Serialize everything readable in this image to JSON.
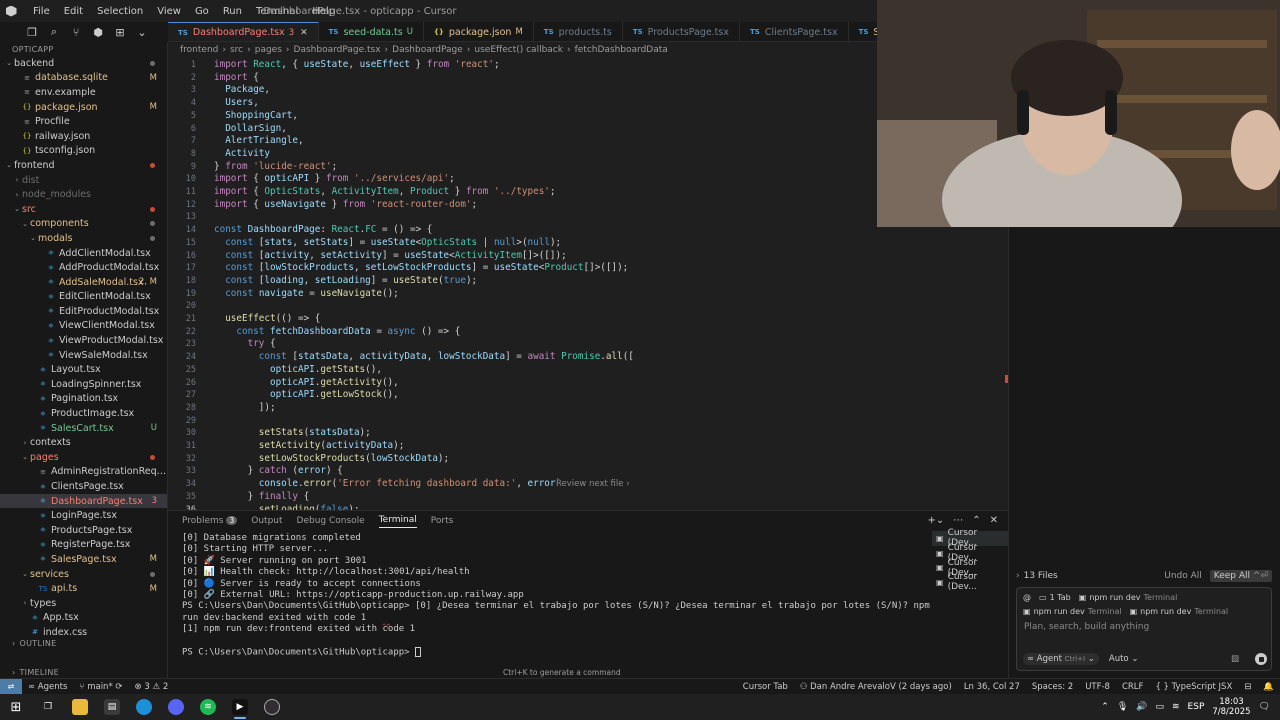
{
  "window": {
    "title": "DashboardPage.tsx - opticapp - Cursor",
    "menu": [
      "File",
      "Edit",
      "Selection",
      "View",
      "Go",
      "Run",
      "Terminal",
      "Help"
    ]
  },
  "explorer": {
    "root": "OPTICAPP",
    "items": [
      {
        "label": "backend",
        "kind": "dir",
        "depth": 0,
        "open": true,
        "status": "dot"
      },
      {
        "label": "database.sqlite",
        "kind": "file",
        "depth": 1,
        "status": "M",
        "color": "mod"
      },
      {
        "label": "env.example",
        "kind": "file",
        "depth": 1
      },
      {
        "label": "package.json",
        "kind": "file",
        "depth": 1,
        "status": "M",
        "color": "mod"
      },
      {
        "label": "Procfile",
        "kind": "file",
        "depth": 1
      },
      {
        "label": "railway.json",
        "kind": "file",
        "depth": 1
      },
      {
        "label": "tsconfig.json",
        "kind": "file",
        "depth": 1
      },
      {
        "label": "frontend",
        "kind": "dir",
        "depth": 0,
        "open": true,
        "status": "reddot"
      },
      {
        "label": "dist",
        "kind": "dir",
        "depth": 1,
        "open": false,
        "color": "dim"
      },
      {
        "label": "node_modules",
        "kind": "dir",
        "depth": 1,
        "open": false,
        "color": "dim"
      },
      {
        "label": "src",
        "kind": "dir",
        "depth": 1,
        "open": true,
        "color": "err",
        "status": "reddot"
      },
      {
        "label": "components",
        "kind": "dir",
        "depth": 2,
        "open": true,
        "color": "mod",
        "status": "dot"
      },
      {
        "label": "modals",
        "kind": "dir",
        "depth": 3,
        "open": true,
        "color": "mod",
        "status": "dot"
      },
      {
        "label": "AddClientModal.tsx",
        "kind": "file",
        "depth": 4
      },
      {
        "label": "AddProductModal.tsx",
        "kind": "file",
        "depth": 4
      },
      {
        "label": "AddSaleModal.tsx",
        "kind": "file",
        "depth": 4,
        "status": "2, M",
        "color": "mod"
      },
      {
        "label": "EditClientModal.tsx",
        "kind": "file",
        "depth": 4
      },
      {
        "label": "EditProductModal.tsx",
        "kind": "file",
        "depth": 4
      },
      {
        "label": "ViewClientModal.tsx",
        "kind": "file",
        "depth": 4
      },
      {
        "label": "ViewProductModal.tsx",
        "kind": "file",
        "depth": 4
      },
      {
        "label": "ViewSaleModal.tsx",
        "kind": "file",
        "depth": 4
      },
      {
        "label": "Layout.tsx",
        "kind": "file",
        "depth": 3
      },
      {
        "label": "LoadingSpinner.tsx",
        "kind": "file",
        "depth": 3
      },
      {
        "label": "Pagination.tsx",
        "kind": "file",
        "depth": 3
      },
      {
        "label": "ProductImage.tsx",
        "kind": "file",
        "depth": 3
      },
      {
        "label": "SalesCart.tsx",
        "kind": "file",
        "depth": 3,
        "status": "U",
        "color": "new"
      },
      {
        "label": "contexts",
        "kind": "dir",
        "depth": 2,
        "open": false
      },
      {
        "label": "pages",
        "kind": "dir",
        "depth": 2,
        "open": true,
        "color": "err",
        "status": "reddot"
      },
      {
        "label": "AdminRegistrationRequestsPag...",
        "kind": "file",
        "depth": 3
      },
      {
        "label": "ClientsPage.tsx",
        "kind": "file",
        "depth": 3
      },
      {
        "label": "DashboardPage.tsx",
        "kind": "file",
        "depth": 3,
        "status": "3",
        "color": "err",
        "selected": true
      },
      {
        "label": "LoginPage.tsx",
        "kind": "file",
        "depth": 3
      },
      {
        "label": "ProductsPage.tsx",
        "kind": "file",
        "depth": 3
      },
      {
        "label": "RegisterPage.tsx",
        "kind": "file",
        "depth": 3
      },
      {
        "label": "SalesPage.tsx",
        "kind": "file",
        "depth": 3,
        "status": "M",
        "color": "mod"
      },
      {
        "label": "services",
        "kind": "dir",
        "depth": 2,
        "open": true,
        "color": "mod",
        "status": "dot"
      },
      {
        "label": "api.ts",
        "kind": "file",
        "depth": 3,
        "status": "M",
        "color": "mod"
      },
      {
        "label": "types",
        "kind": "dir",
        "depth": 2,
        "open": false
      },
      {
        "label": "App.tsx",
        "kind": "file",
        "depth": 2
      },
      {
        "label": "index.css",
        "kind": "file",
        "depth": 2
      }
    ],
    "outline": "OUTLINE",
    "timeline": "TIMELINE"
  },
  "tabs": [
    {
      "label": "DashboardPage.tsx",
      "badge": "3",
      "color": "err",
      "active": true,
      "icon": "TS"
    },
    {
      "label": "seed-data.ts",
      "badge": "U",
      "color": "new",
      "icon": "TS"
    },
    {
      "label": "package.json",
      "badge": "M",
      "color": "mod",
      "icon": "{}"
    },
    {
      "label": "products.ts",
      "badge": "",
      "color": "dim",
      "icon": "TS"
    },
    {
      "label": "ProductsPage.tsx",
      "badge": "",
      "color": "dim",
      "icon": "TS"
    },
    {
      "label": "ClientsPage.tsx",
      "badge": "",
      "color": "dim",
      "icon": "TS"
    },
    {
      "label": "SalesPage.tsx",
      "badge": "M",
      "color": "mod",
      "icon": "TS"
    }
  ],
  "breadcrumb": [
    "frontend",
    "src",
    "pages",
    "DashboardPage.tsx",
    "DashboardPage",
    "useEffect() callback",
    "fetchDashboardData"
  ],
  "code": [
    {
      "n": "1",
      "t": "import React, { useState, useEffect } from 'react';"
    },
    {
      "n": "2",
      "t": "import {"
    },
    {
      "n": "3",
      "t": "  Package,"
    },
    {
      "n": "4",
      "t": "  Users,"
    },
    {
      "n": "5",
      "t": "  ShoppingCart,"
    },
    {
      "n": "6",
      "t": "  DollarSign,"
    },
    {
      "n": "7",
      "t": "  AlertTriangle,"
    },
    {
      "n": "8",
      "t": "  Activity"
    },
    {
      "n": "9",
      "t": "} from 'lucide-react';"
    },
    {
      "n": "10",
      "t": "import { opticAPI } from '../services/api';"
    },
    {
      "n": "11",
      "t": "import { OpticStats, ActivityItem, Product } from '../types';"
    },
    {
      "n": "12",
      "t": "import { useNavigate } from 'react-router-dom';"
    },
    {
      "n": "13",
      "t": ""
    },
    {
      "n": "14",
      "t": "const DashboardPage: React.FC = () => {"
    },
    {
      "n": "15",
      "t": "  const [stats, setStats] = useState<OpticStats | null>(null);"
    },
    {
      "n": "16",
      "t": "  const [activity, setActivity] = useState<ActivityItem[]>([]);"
    },
    {
      "n": "17",
      "t": "  const [lowStockProducts, setLowStockProducts] = useState<Product[]>([]);"
    },
    {
      "n": "18",
      "t": "  const [loading, setLoading] = useState(true);"
    },
    {
      "n": "19",
      "t": "  const navigate = useNavigate();"
    },
    {
      "n": "20",
      "t": ""
    },
    {
      "n": "21",
      "t": "  useEffect(() => {"
    },
    {
      "n": "22",
      "t": "    const fetchDashboardData = async () => {"
    },
    {
      "n": "23",
      "t": "      try {"
    },
    {
      "n": "24",
      "t": "        const [statsData, activityData, lowStockData] = await Promise.all(["
    },
    {
      "n": "25",
      "t": "          opticAPI.getStats(),"
    },
    {
      "n": "26",
      "t": "          opticAPI.getActivity(),"
    },
    {
      "n": "27",
      "t": "          opticAPI.getLowStock(),"
    },
    {
      "n": "28",
      "t": "        ]);"
    },
    {
      "n": "29",
      "t": ""
    },
    {
      "n": "30",
      "t": "        setStats(statsData);"
    },
    {
      "n": "31",
      "t": "        setActivity(activityData);"
    },
    {
      "n": "32",
      "t": "        setLowStockProducts(lowStockData);"
    },
    {
      "n": "33",
      "t": "      } catch (error) {"
    },
    {
      "n": "34",
      "t": "        console.error('Error fetching dashboard data:', error);"
    },
    {
      "n": "35",
      "t": "      } finally {"
    },
    {
      "n": "36",
      "t": "        setLoading(false);"
    }
  ],
  "review_hint": "Review next file",
  "panel": {
    "tabs": [
      "Problems",
      "Output",
      "Debug Console",
      "Terminal",
      "Ports"
    ],
    "problems_count": "3",
    "active_tab": "Terminal",
    "terminal_lines": [
      "[0] Database migrations completed",
      "[0] Starting HTTP server...",
      "[0] 🚀 Server running on port 3001",
      "[0] 📊 Health check: http://localhost:3001/api/health",
      "[0] 🔵 Server is ready to accept connections",
      "[0] 🔗 External URL: https://opticapp-production.up.railway.app",
      "PS C:\\Users\\Dan\\Documents\\GitHub\\opticapp> [0] ¿Desea terminar el trabajo por lotes (S/N)? ¿Desea terminar el trabajo por lotes (S/N)? npm run dev:backend exited with code 1",
      "[1] npm run dev:frontend exited with code 1",
      "",
      "PS C:\\Users\\Dan\\Documents\\GitHub\\opticapp> "
    ],
    "ctrlc": "^C",
    "terminals": [
      "Cursor (Dev...",
      "Cursor (Dev...",
      "Cursor (Dev...",
      "Cursor (Dev..."
    ],
    "hint": "Ctrl+K to generate a command"
  },
  "agent": {
    "files_count": "13 Files",
    "undo_all": "Undo All",
    "keep_all": "Keep All",
    "keep_shortcut": "^⏎",
    "tabs_chip": "1 Tab",
    "chip1": "npm run dev",
    "chip1_sub": "Terminal",
    "chip2": "npm run dev",
    "chip2_sub": "Terminal",
    "chip3": "npm run dev",
    "chip3_sub": "Terminal",
    "placeholder": "Plan, search, build anything",
    "mode": "Agent",
    "mode_shortcut": "Ctrl+I",
    "model": "Auto"
  },
  "statusbar": {
    "agents": "Agents",
    "branch": "main*",
    "errors": "3",
    "warnings": "2",
    "cursor_tab": "Cursor Tab",
    "blame": "Dan Andre ArevaloV (2 days ago)",
    "position": "Ln 36, Col 27",
    "spaces": "Spaces: 2",
    "encoding": "UTF-8",
    "eol": "CRLF",
    "language": "TypeScript JSX"
  },
  "taskbar": {
    "lang": "ESP",
    "time": "18:03",
    "date": "7/8/2025"
  }
}
